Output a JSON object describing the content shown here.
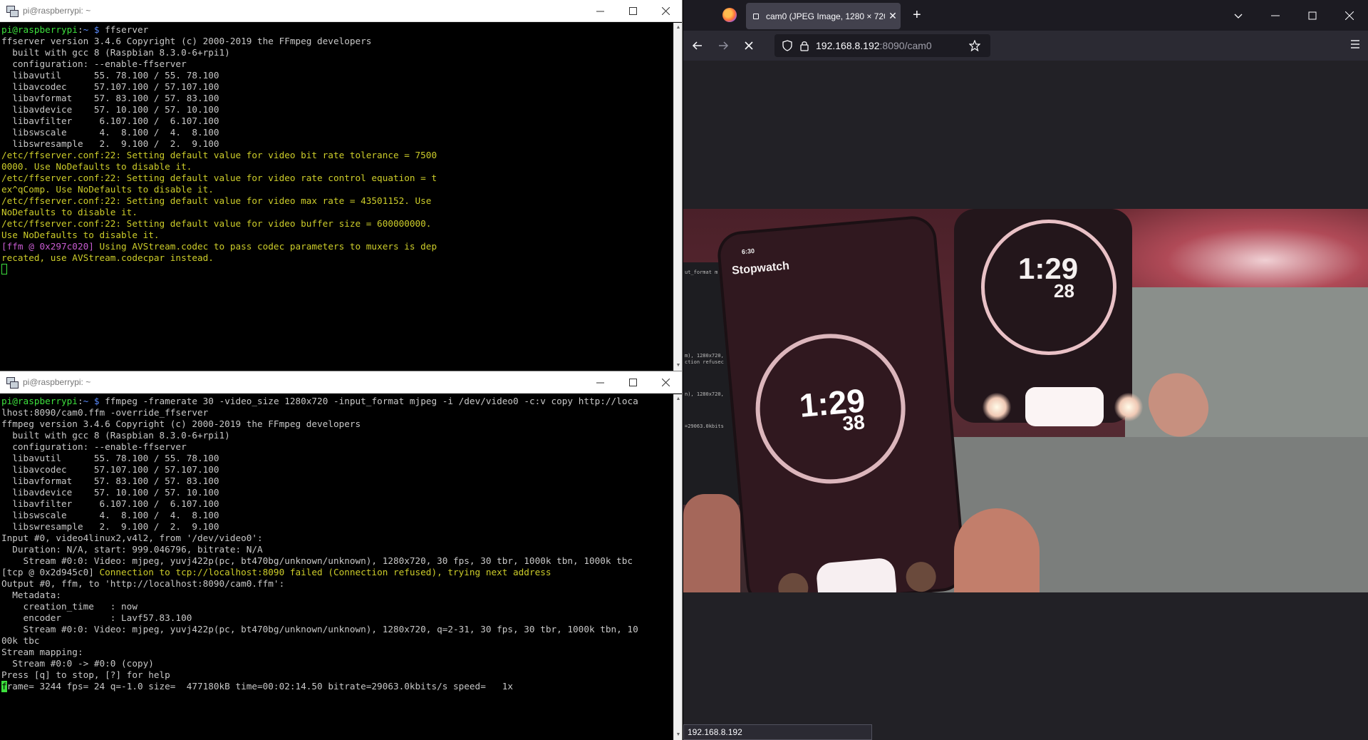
{
  "putty_top": {
    "title": "pi@raspberrypi: ~",
    "lines": [
      [
        {
          "t": "pi@raspberrypi",
          "c": "g"
        },
        {
          "t": ":",
          "c": ""
        },
        {
          "t": "~ $",
          "c": "b"
        },
        {
          "t": " ffserver",
          "c": ""
        }
      ],
      [
        {
          "t": "ffserver version 3.4.6 Copyright (c) 2000-2019 the FFmpeg developers",
          "c": ""
        }
      ],
      [
        {
          "t": "  built with gcc 8 (Raspbian 8.3.0-6+rpi1)",
          "c": ""
        }
      ],
      [
        {
          "t": "  configuration: --enable-ffserver",
          "c": ""
        }
      ],
      [
        {
          "t": "  libavutil      55. 78.100 / 55. 78.100",
          "c": ""
        }
      ],
      [
        {
          "t": "  libavcodec     57.107.100 / 57.107.100",
          "c": ""
        }
      ],
      [
        {
          "t": "  libavformat    57. 83.100 / 57. 83.100",
          "c": ""
        }
      ],
      [
        {
          "t": "  libavdevice    57. 10.100 / 57. 10.100",
          "c": ""
        }
      ],
      [
        {
          "t": "  libavfilter     6.107.100 /  6.107.100",
          "c": ""
        }
      ],
      [
        {
          "t": "  libswscale      4.  8.100 /  4.  8.100",
          "c": ""
        }
      ],
      [
        {
          "t": "  libswresample   2.  9.100 /  2.  9.100",
          "c": ""
        }
      ],
      [
        {
          "t": "/etc/ffserver.conf:22: Setting default value for video bit rate tolerance = 7500",
          "c": "y"
        }
      ],
      [
        {
          "t": "0000. Use NoDefaults to disable it.",
          "c": "y"
        }
      ],
      [
        {
          "t": "/etc/ffserver.conf:22: Setting default value for video rate control equation = t",
          "c": "y"
        }
      ],
      [
        {
          "t": "ex^qComp. Use NoDefaults to disable it.",
          "c": "y"
        }
      ],
      [
        {
          "t": "/etc/ffserver.conf:22: Setting default value for video max rate = 43501152. Use",
          "c": "y"
        }
      ],
      [
        {
          "t": "NoDefaults to disable it.",
          "c": "y"
        }
      ],
      [
        {
          "t": "/etc/ffserver.conf:22: Setting default value for video buffer size = 600000000.",
          "c": "y"
        }
      ],
      [
        {
          "t": "Use NoDefaults to disable it.",
          "c": "y"
        }
      ],
      [
        {
          "t": "[ffm @ 0x297c020] ",
          "c": "m"
        },
        {
          "t": "Using AVStream.codec to pass codec parameters to muxers is dep",
          "c": "y"
        }
      ],
      [
        {
          "t": "recated, use AVStream.codecpar instead.",
          "c": "y"
        }
      ]
    ]
  },
  "putty_bottom": {
    "title": "pi@raspberrypi: ~",
    "lines": [
      [
        {
          "t": "pi@raspberrypi",
          "c": "g"
        },
        {
          "t": ":",
          "c": ""
        },
        {
          "t": "~ $",
          "c": "b"
        },
        {
          "t": " ffmpeg -framerate 30 -video_size 1280x720 -input_format mjpeg -i /dev/video0 -c:v copy http://loca",
          "c": ""
        }
      ],
      [
        {
          "t": "lhost:8090/cam0.ffm -override_ffserver",
          "c": ""
        }
      ],
      [
        {
          "t": "ffmpeg version 3.4.6 Copyright (c) 2000-2019 the FFmpeg developers",
          "c": ""
        }
      ],
      [
        {
          "t": "  built with gcc 8 (Raspbian 8.3.0-6+rpi1)",
          "c": ""
        }
      ],
      [
        {
          "t": "  configuration: --enable-ffserver",
          "c": ""
        }
      ],
      [
        {
          "t": "  libavutil      55. 78.100 / 55. 78.100",
          "c": ""
        }
      ],
      [
        {
          "t": "  libavcodec     57.107.100 / 57.107.100",
          "c": ""
        }
      ],
      [
        {
          "t": "  libavformat    57. 83.100 / 57. 83.100",
          "c": ""
        }
      ],
      [
        {
          "t": "  libavdevice    57. 10.100 / 57. 10.100",
          "c": ""
        }
      ],
      [
        {
          "t": "  libavfilter     6.107.100 /  6.107.100",
          "c": ""
        }
      ],
      [
        {
          "t": "  libswscale      4.  8.100 /  4.  8.100",
          "c": ""
        }
      ],
      [
        {
          "t": "  libswresample   2.  9.100 /  2.  9.100",
          "c": ""
        }
      ],
      [
        {
          "t": "Input #0, video4linux2,v4l2, from '/dev/video0':",
          "c": ""
        }
      ],
      [
        {
          "t": "  Duration: N/A, start: 999.046796, bitrate: N/A",
          "c": ""
        }
      ],
      [
        {
          "t": "    Stream #0:0: Video: mjpeg, yuvj422p(pc, bt470bg/unknown/unknown), 1280x720, 30 fps, 30 tbr, 1000k tbn, 1000k tbc",
          "c": ""
        }
      ],
      [
        {
          "t": "[tcp @ 0x2d945c0] ",
          "c": ""
        },
        {
          "t": "Connection to tcp://localhost:8090 failed (Connection refused), trying next address",
          "c": "y"
        }
      ],
      [
        {
          "t": "Output #0, ffm, to 'http://localhost:8090/cam0.ffm':",
          "c": ""
        }
      ],
      [
        {
          "t": "  Metadata:",
          "c": ""
        }
      ],
      [
        {
          "t": "    creation_time   : now",
          "c": ""
        }
      ],
      [
        {
          "t": "    encoder         : Lavf57.83.100",
          "c": ""
        }
      ],
      [
        {
          "t": "    Stream #0:0: Video: mjpeg, yuvj422p(pc, bt470bg/unknown/unknown), 1280x720, q=2-31, 30 fps, 30 tbr, 1000k tbn, 10",
          "c": ""
        }
      ],
      [
        {
          "t": "00k tbc",
          "c": ""
        }
      ],
      [
        {
          "t": "Stream mapping:",
          "c": ""
        }
      ],
      [
        {
          "t": "  Stream #0:0 -> #0:0 (copy)",
          "c": ""
        }
      ],
      [
        {
          "t": "Press [q] to stop, [?] for help",
          "c": ""
        }
      ],
      [
        {
          "t": "frame= 3244 fps= 24 q=-1.0 size=  477180kB time=00:02:14.50 bitrate=29063.0kbits/s speed=   1x",
          "c": ""
        }
      ]
    ]
  },
  "firefox": {
    "tab_title": "cam0 (JPEG Image, 1280 × 720 p",
    "url_host": "192.168.8.192",
    "url_rest": ":8090/cam0",
    "status_url": "192.168.8.192",
    "photo": {
      "phone_status": "6:30",
      "phone_title": "Stopwatch",
      "phone_time": "1:29",
      "phone_sub": "38",
      "watch_time": "1:29",
      "watch_sub": "28",
      "monitor_lines": [
        "ut_format m",
        "",
        "",
        "",
        "",
        "",
        "",
        "",
        "",
        "",
        "",
        "",
        "",
        "m), 1280x720,",
        "ction refusec",
        "",
        "",
        "",
        "",
        "n), 1280x720,",
        "",
        "",
        "",
        "",
        "=29063.0kbits"
      ]
    }
  }
}
